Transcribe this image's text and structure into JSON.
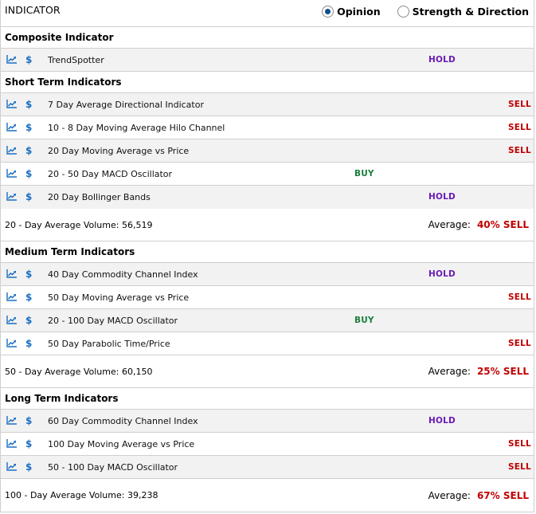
{
  "header": {
    "title": "INDICATOR",
    "view_options": [
      {
        "label": "Opinion",
        "selected": true
      },
      {
        "label": "Strength & Direction",
        "selected": false
      }
    ]
  },
  "colors": {
    "buy": "#1a7f3c",
    "hold": "#6a1bb5",
    "sell": "#c00000",
    "icon": "#1b6ec2"
  },
  "icons": {
    "chart": "line-chart-icon",
    "price": "dollar-icon",
    "dollar_glyph": "$"
  },
  "sections": [
    {
      "title": "Composite Indicator",
      "rows": [
        {
          "label": "TrendSpotter",
          "signal": "HOLD"
        }
      ]
    },
    {
      "title": "Short Term Indicators",
      "rows": [
        {
          "label": "7 Day Average Directional Indicator",
          "signal": "SELL"
        },
        {
          "label": "10 - 8 Day Moving Average Hilo Channel",
          "signal": "SELL"
        },
        {
          "label": "20 Day Moving Average vs Price",
          "signal": "SELL"
        },
        {
          "label": "20 - 50 Day MACD Oscillator",
          "signal": "BUY"
        },
        {
          "label": "20 Day Bollinger Bands",
          "signal": "HOLD"
        }
      ],
      "summary": {
        "volume": "20 - Day Average Volume: 56,519",
        "average_label": "Average:",
        "average_value": "40% SELL"
      }
    },
    {
      "title": "Medium Term Indicators",
      "rows": [
        {
          "label": "40 Day Commodity Channel Index",
          "signal": "HOLD"
        },
        {
          "label": "50 Day Moving Average vs Price",
          "signal": "SELL"
        },
        {
          "label": "20 - 100 Day MACD Oscillator",
          "signal": "BUY"
        },
        {
          "label": "50 Day Parabolic Time/Price",
          "signal": "SELL"
        }
      ],
      "summary": {
        "volume": "50 - Day Average Volume: 60,150",
        "average_label": "Average:",
        "average_value": "25% SELL"
      }
    },
    {
      "title": "Long Term Indicators",
      "rows": [
        {
          "label": "60 Day Commodity Channel Index",
          "signal": "HOLD"
        },
        {
          "label": "100 Day Moving Average vs Price",
          "signal": "SELL"
        },
        {
          "label": "50 - 100 Day MACD Oscillator",
          "signal": "SELL"
        }
      ],
      "summary": {
        "volume": "100 - Day Average Volume: 39,238",
        "average_label": "Average:",
        "average_value": "67% SELL"
      }
    }
  ]
}
